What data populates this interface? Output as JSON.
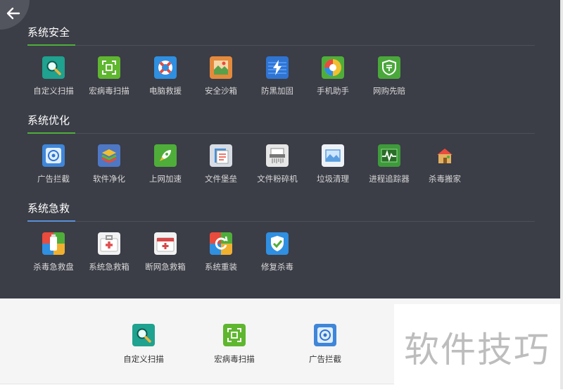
{
  "back_button": {
    "icon": "back-arrow-icon"
  },
  "sections": [
    {
      "title": "系统安全",
      "tools": [
        {
          "label": "自定义扫描",
          "icon": "magnifier-icon",
          "color": "#1fa28f"
        },
        {
          "label": "宏病毒扫描",
          "icon": "scan-frame-icon",
          "color": "#5fb62f"
        },
        {
          "label": "电脑救援",
          "icon": "lifebuoy-icon",
          "color": "#2f8fe0"
        },
        {
          "label": "安全沙箱",
          "icon": "sandbox-icon",
          "color": "#e48a3c"
        },
        {
          "label": "防黑加固",
          "icon": "lightning-shield-icon",
          "color": "#2f74d0"
        },
        {
          "label": "手机助手",
          "icon": "phone-ball-icon",
          "color": "#e94b3c"
        },
        {
          "label": "网购先赔",
          "icon": "shop-shield-icon",
          "color": "#4aa83a"
        }
      ]
    },
    {
      "title": "系统优化",
      "tools": [
        {
          "label": "广告拦截",
          "icon": "target-icon",
          "color": "#3f86d8"
        },
        {
          "label": "软件净化",
          "icon": "layers-icon",
          "color": "#4e78c4"
        },
        {
          "label": "上网加速",
          "icon": "rocket-icon",
          "color": "#4fae3a"
        },
        {
          "label": "文件堡垒",
          "icon": "file-vault-icon",
          "color": "#4a8fd4"
        },
        {
          "label": "文件粉碎机",
          "icon": "shredder-icon",
          "color": "#c8c8c8"
        },
        {
          "label": "垃圾清理",
          "icon": "broom-landscape-icon",
          "color": "#5a9fe0"
        },
        {
          "label": "进程追踪器",
          "icon": "pulse-icon",
          "color": "#3e9a3a"
        },
        {
          "label": "杀毒搬家",
          "icon": "house-icon",
          "color": "#c9973b"
        }
      ]
    },
    {
      "title": "系统急救",
      "tools": [
        {
          "label": "杀毒急救盘",
          "icon": "usb-rescue-icon",
          "color": "#e94b3c"
        },
        {
          "label": "系统急救箱",
          "icon": "first-aid-kit-icon",
          "color": "#e05050"
        },
        {
          "label": "断网急救箱",
          "icon": "network-aid-icon",
          "color": "#d84848"
        },
        {
          "label": "系统重装",
          "icon": "refresh-icon",
          "color": "#e0683a"
        },
        {
          "label": "修复杀毒",
          "icon": "repair-shield-icon",
          "color": "#2f8fe0"
        }
      ]
    }
  ],
  "favorites": [
    {
      "label": "自定义扫描",
      "icon": "magnifier-icon"
    },
    {
      "label": "宏病毒扫描",
      "icon": "scan-frame-icon"
    },
    {
      "label": "广告拦截",
      "icon": "target-icon"
    }
  ],
  "watermark": "软件技巧"
}
